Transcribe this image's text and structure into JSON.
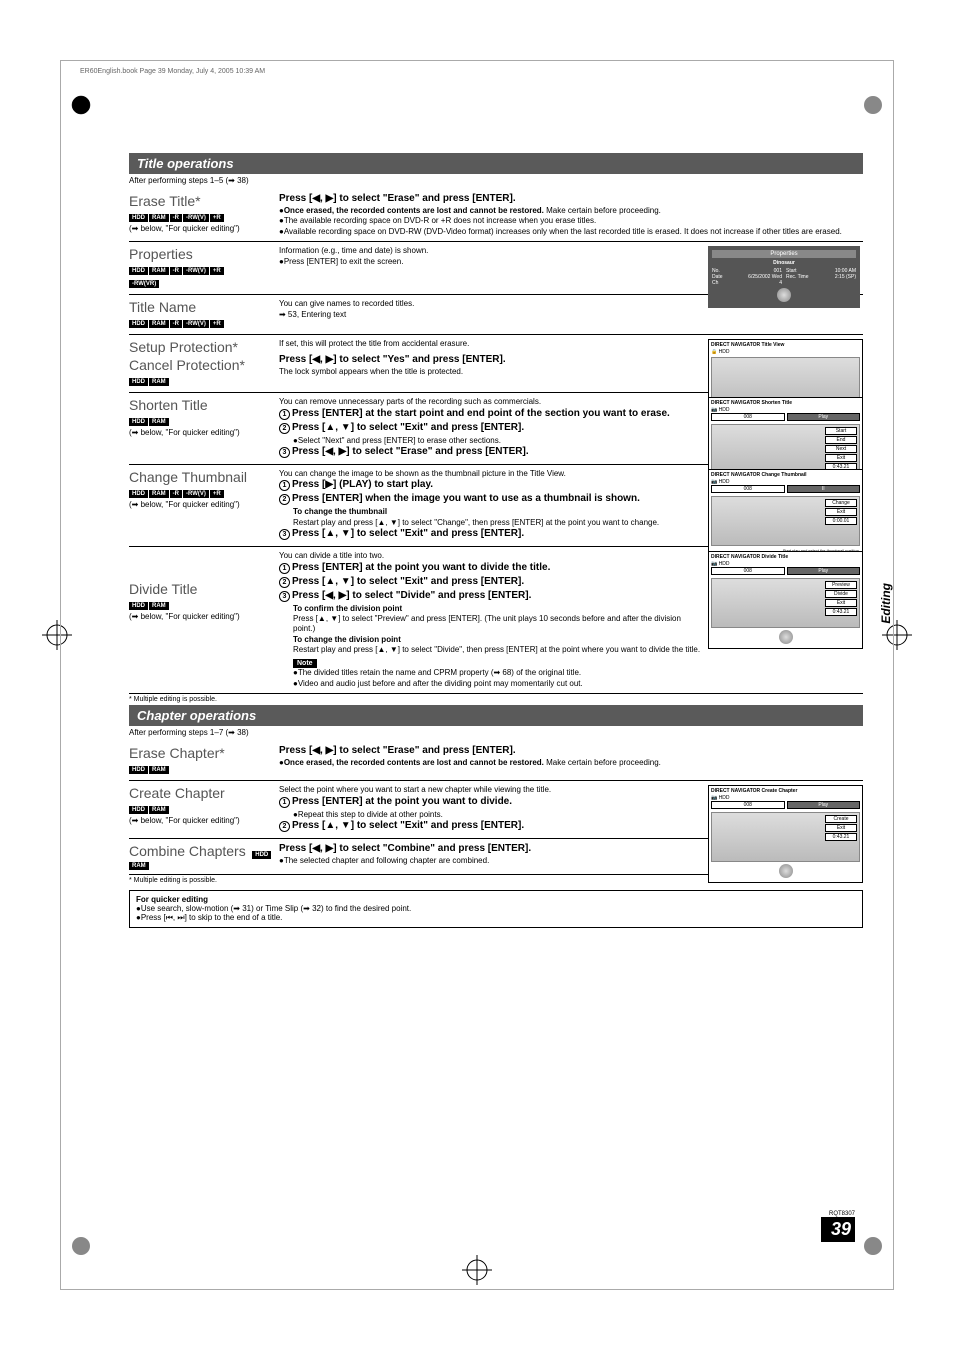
{
  "header_line": "ER60English.book  Page 39  Monday, July 4, 2005  10:39 AM",
  "side_tab": "Editing",
  "page_ref": "RQT8307",
  "page_number": "39",
  "sections": {
    "title_ops": {
      "bar": "Title operations",
      "after": "After performing steps 1–5 (➡ 38)"
    },
    "chapter_ops": {
      "bar": "Chapter operations",
      "after": "After performing steps 1–7 (➡ 38)"
    }
  },
  "tags": {
    "hdd": "HDD",
    "ram": "RAM",
    "r": "-R",
    "rwv": "-RW(V)",
    "plusr": "+R",
    "rwvr": "-RW(VR)"
  },
  "erase_title": {
    "name": "Erase Title*",
    "sub": "(➡ below, \"For quicker editing\")",
    "instr": "Press [◀, ▶] to select \"Erase\" and press [ENTER].",
    "b1": "●Once erased, the recorded contents are lost and cannot be restored. ",
    "b1_tail": "Make certain before proceeding.",
    "b2": "●The available recording space on DVD-R or +R does not increase when you erase titles.",
    "b3": "●Available recording space on DVD-RW (DVD-Video format) increases only when the last recorded title is erased. It does not increase if other titles are erased."
  },
  "properties": {
    "name": "Properties",
    "t1": "Information (e.g., time and date) is shown.",
    "t2": "●Press [ENTER] to exit the screen.",
    "osd": {
      "title": "Properties",
      "prog": "Dinosaur",
      "no_l": "No.",
      "no_v": "001",
      "date_l": "Date",
      "date_v": "6/25/2002 Wed",
      "ch_l": "Ch",
      "ch_v": "4",
      "start_l": "Start",
      "start_v": "10:00 AM",
      "rec_l": "Rec. Time",
      "rec_v": "2:15 (SP)"
    }
  },
  "title_name": {
    "name": "Title Name",
    "t1": "You can give names to recorded titles.",
    "t2": "➡ 53, Entering text"
  },
  "protection": {
    "name1": "Setup Protection*",
    "name2": "Cancel Protection*",
    "intro": "If set, this will protect the title from accidental erasure.",
    "instr": "Press [◀, ▶] to select \"Yes\" and press [ENTER].",
    "t3": "The lock symbol appears when the title is protected.",
    "osd_title": "DIRECT NAVIGATOR   Title View",
    "osd_hdd": "HDD"
  },
  "shorten": {
    "name": "Shorten Title",
    "sub": "(➡ below, \"For quicker editing\")",
    "intro": "You can remove unnecessary parts of the recording such as commercials.",
    "s1": "Press [ENTER] at the start point and end point of the section you want to erase.",
    "s2": "Press [▲, ▼] to select \"Exit\" and press [ENTER].",
    "s2b": "●Select \"Next\" and press [ENTER] to erase other sections.",
    "s3": "Press [◀, ▶] to select \"Erase\" and press [ENTER].",
    "osd": {
      "title": "DIRECT NAVIGATOR   Shorten Title",
      "btns": [
        "Start",
        "End",
        "Next",
        "Exit"
      ],
      "time": "0:43.21"
    }
  },
  "thumb": {
    "name": "Change Thumbnail",
    "sub": "(➡ below, \"For quicker editing\")",
    "intro": "You can change the image to be shown as the thumbnail picture in the Title View.",
    "s1": "Press [▶] (PLAY) to start play.",
    "s2": "Press [ENTER] when the image you want to use as a thumbnail is shown.",
    "s2h": "To change the thumbnail",
    "s2t": "Restart play and press [▲, ▼] to select \"Change\", then press [ENTER] at the point you want to change.",
    "s3": "Press [▲, ▼] to select \"Exit\" and press [ENTER].",
    "osd": {
      "title": "DIRECT NAVIGATOR  Change Thumbnail",
      "btns": [
        "Change",
        "Exit"
      ],
      "time": "0:00.01",
      "note": "Start play and select the thumbnail position."
    }
  },
  "divide": {
    "name": "Divide Title",
    "sub": "(➡ below, \"For quicker editing\")",
    "intro": "You can divide a title into two.",
    "s1": "Press [ENTER] at the point you want to divide the title.",
    "s2": "Press [▲, ▼] to select \"Exit\" and press [ENTER].",
    "s3": "Press [◀, ▶] to select \"Divide\" and press [ENTER].",
    "c_h": "To confirm the division point",
    "c_t": "Press [▲, ▼] to select \"Preview\" and press [ENTER]. (The unit plays 10 seconds before and after the division point.)",
    "d_h": "To change the division point",
    "d_t": "Restart play and press [▲, ▼] to select \"Divide\", then press [ENTER] at the point where you want to divide the title.",
    "note_label": "Note",
    "n1": "●The divided titles retain the name and CPRM property (➡ 68) of the original title.",
    "n2": "●Video and audio just before and after the dividing point may momentarily cut out.",
    "osd": {
      "title": "DIRECT NAVIGATOR   Divide Title",
      "btns": [
        "Preview",
        "Divide",
        "Exit"
      ],
      "time": "0:43.21"
    }
  },
  "multi_note": "* Multiple editing is possible.",
  "erase_chapter": {
    "name": "Erase Chapter*",
    "instr": "Press [◀, ▶] to select \"Erase\" and press [ENTER].",
    "b1": "●Once erased, the recorded contents are lost and cannot be restored. ",
    "b1_tail": "Make certain before proceeding."
  },
  "create_chapter": {
    "name": "Create Chapter",
    "sub": "(➡ below, \"For quicker editing\")",
    "intro": "Select the point where you want to start a new chapter while viewing the title.",
    "s1": "Press [ENTER] at the point you want to divide.",
    "s1b": "●Repeat this step to divide at other points.",
    "s2": "Press [▲, ▼] to select \"Exit\" and press [ENTER].",
    "osd": {
      "title": "DIRECT NAVIGATOR   Create Chapter",
      "btns": [
        "Create",
        "Exit"
      ],
      "time": "0:43.21"
    }
  },
  "combine": {
    "name": "Combine Chapters",
    "instr": "Press [◀, ▶] to select \"Combine\" and press [ENTER].",
    "t1": "●The selected chapter and following chapter are combined."
  },
  "quick": {
    "h": "For quicker editing",
    "l1": "●Use search, slow-motion (➡ 31) or Time Slip (➡ 32) to find the desired point.",
    "l2": "●Press [⏮, ⏭] to skip to the end of a title."
  },
  "osd_common": {
    "hdd": "HDD",
    "play_label": "Play",
    "thumb_num": "008",
    "ii": "II"
  }
}
